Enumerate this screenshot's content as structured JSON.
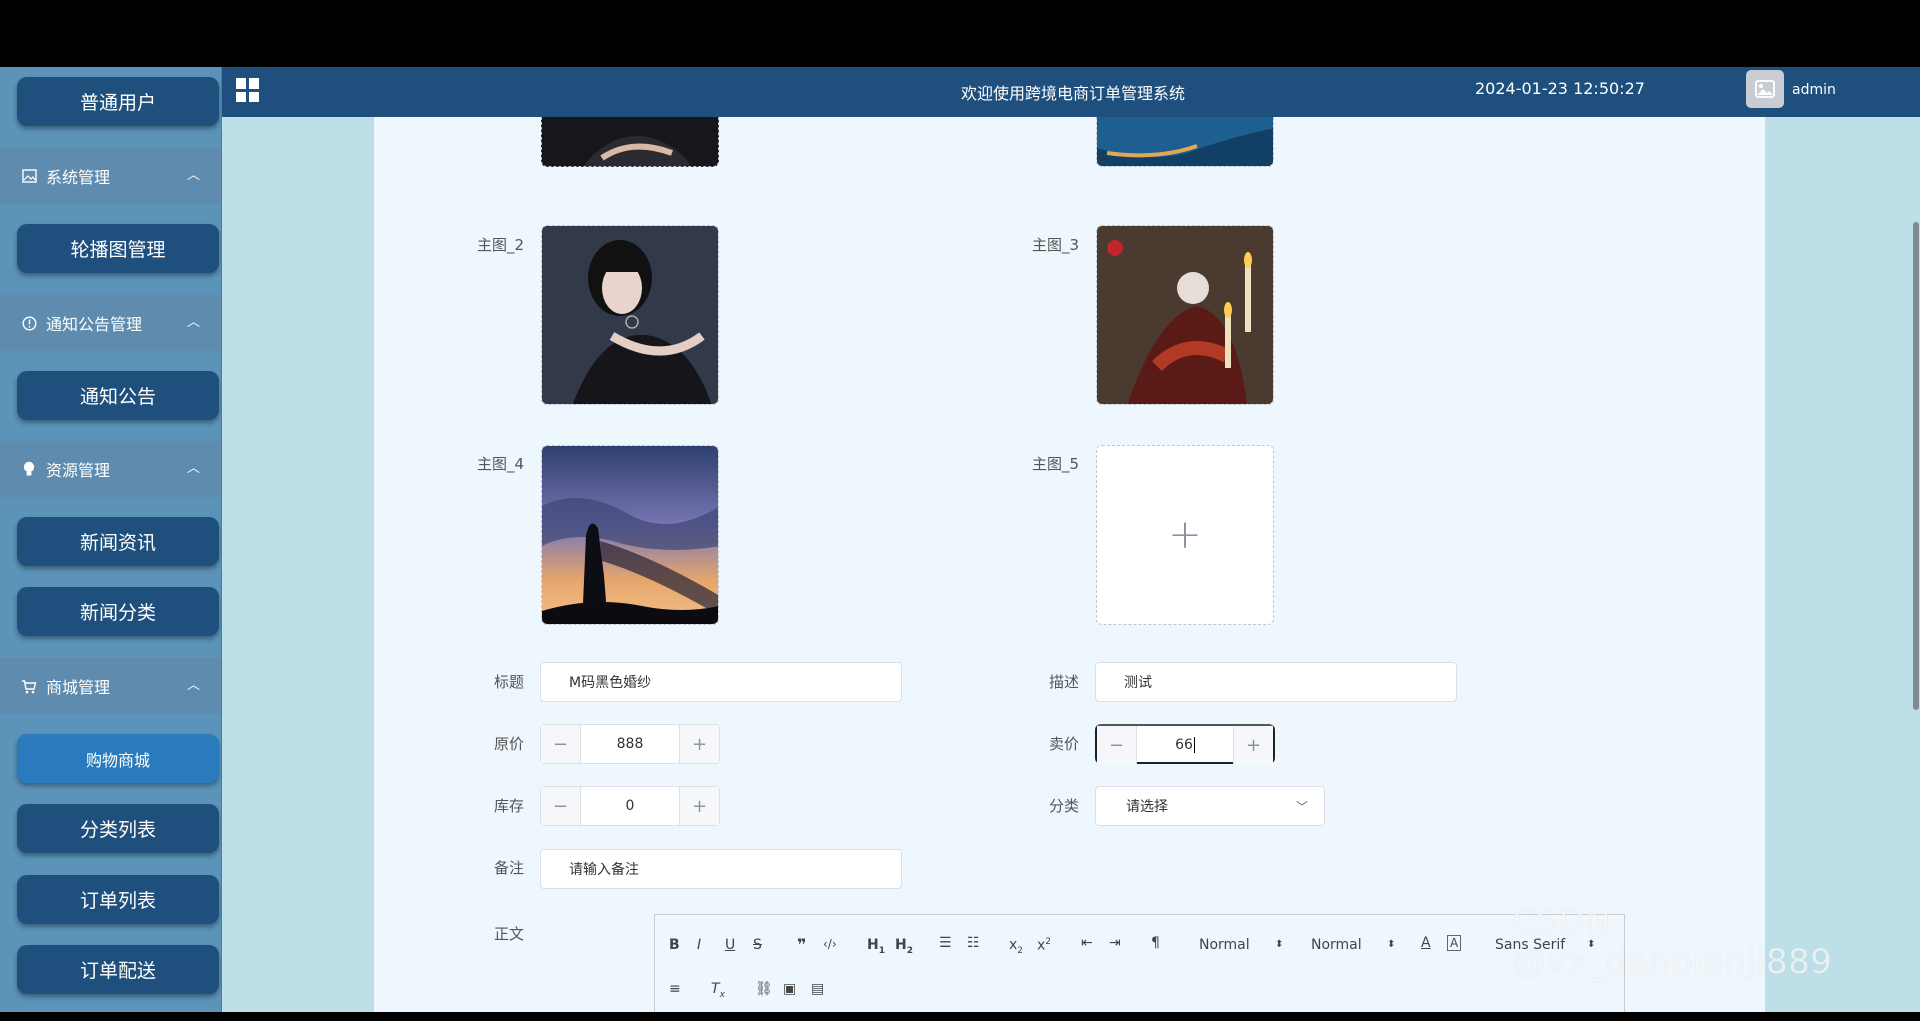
{
  "sidebar": {
    "items": [
      {
        "type": "button",
        "label": "普通用户"
      },
      {
        "type": "group",
        "label": "系统管理",
        "icon": "image-icon"
      },
      {
        "type": "button",
        "label": "轮播图管理"
      },
      {
        "type": "group",
        "label": "通知公告管理",
        "icon": "info-icon"
      },
      {
        "type": "button",
        "label": "通知公告"
      },
      {
        "type": "group",
        "label": "资源管理",
        "icon": "bulb-icon"
      },
      {
        "type": "button",
        "label": "新闻资讯"
      },
      {
        "type": "button",
        "label": "新闻分类"
      },
      {
        "type": "group",
        "label": "商城管理",
        "icon": "cart-icon"
      },
      {
        "type": "button",
        "label": "购物商城",
        "active": true
      },
      {
        "type": "button",
        "label": "分类列表"
      },
      {
        "type": "button",
        "label": "订单列表"
      },
      {
        "type": "button",
        "label": "订单配送"
      }
    ]
  },
  "header": {
    "title": "欢迎使用跨境电商订单管理系统",
    "datetime": "2024-01-23 12:50:27",
    "username": "admin"
  },
  "form": {
    "images": {
      "main2_label": "主图_2",
      "main3_label": "主图_3",
      "main4_label": "主图_4",
      "main5_label": "主图_5",
      "upload_plus": "+"
    },
    "title": {
      "label": "标题",
      "value": "M码黑色婚纱"
    },
    "description": {
      "label": "描述",
      "value": "测试"
    },
    "original_price": {
      "label": "原价",
      "value": "888"
    },
    "sale_price": {
      "label": "卖价",
      "value": "66"
    },
    "stock": {
      "label": "库存",
      "value": "0"
    },
    "category": {
      "label": "分类",
      "placeholder": "请选择"
    },
    "remark": {
      "label": "备注",
      "placeholder": "请输入备注"
    },
    "body": {
      "label": "正文"
    }
  },
  "editor_toolbar": {
    "header_select": "Normal",
    "size_select": "Normal",
    "font_select": "Sans Serif"
  },
  "watermark": "CSDN @vx_danpianji889",
  "colors": {
    "sidebar_bg": "#5b93b9",
    "nav_button": "#1e4f7d",
    "nav_button_active": "#2a7bbd",
    "topbar": "#1e4f7d",
    "content_bg": "#eef7fd",
    "page_bg": "#bde0e8"
  }
}
